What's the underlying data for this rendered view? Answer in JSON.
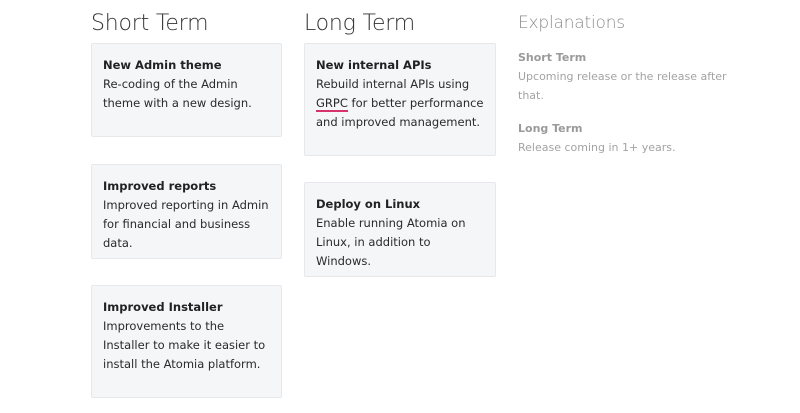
{
  "columns": {
    "short_term": {
      "title": "Short Term",
      "cards": [
        {
          "title": "New Admin theme",
          "body": "Re-coding of the Admin theme with a new design."
        },
        {
          "title": "Improved reports",
          "body": "Improved reporting in Admin for financial and business data."
        },
        {
          "title": "Improved Installer",
          "body": "Improvements to the Installer to make it easier to install the Atomia platform."
        }
      ]
    },
    "long_term": {
      "title": "Long Term",
      "cards": [
        {
          "title": "New internal APIs",
          "body_prefix": "Rebuild internal APIs using ",
          "link": "GRPC",
          "body_suffix": " for better performance and improved management."
        },
        {
          "title": "Deploy on Linux",
          "body": "Enable running Atomia on Linux, in addition to Windows."
        }
      ]
    },
    "explanations": {
      "title": "Explanations",
      "items": [
        {
          "title": "Short Term",
          "body": "Upcoming release or the release after that."
        },
        {
          "title": "Long Term",
          "body": "Release coming in 1+ years."
        }
      ]
    }
  },
  "colors": {
    "card_background": "#f5f6f8",
    "card_border": "#e6e8eb",
    "link_underline": "#d6336c",
    "muted_text": "#9a9a9a"
  }
}
